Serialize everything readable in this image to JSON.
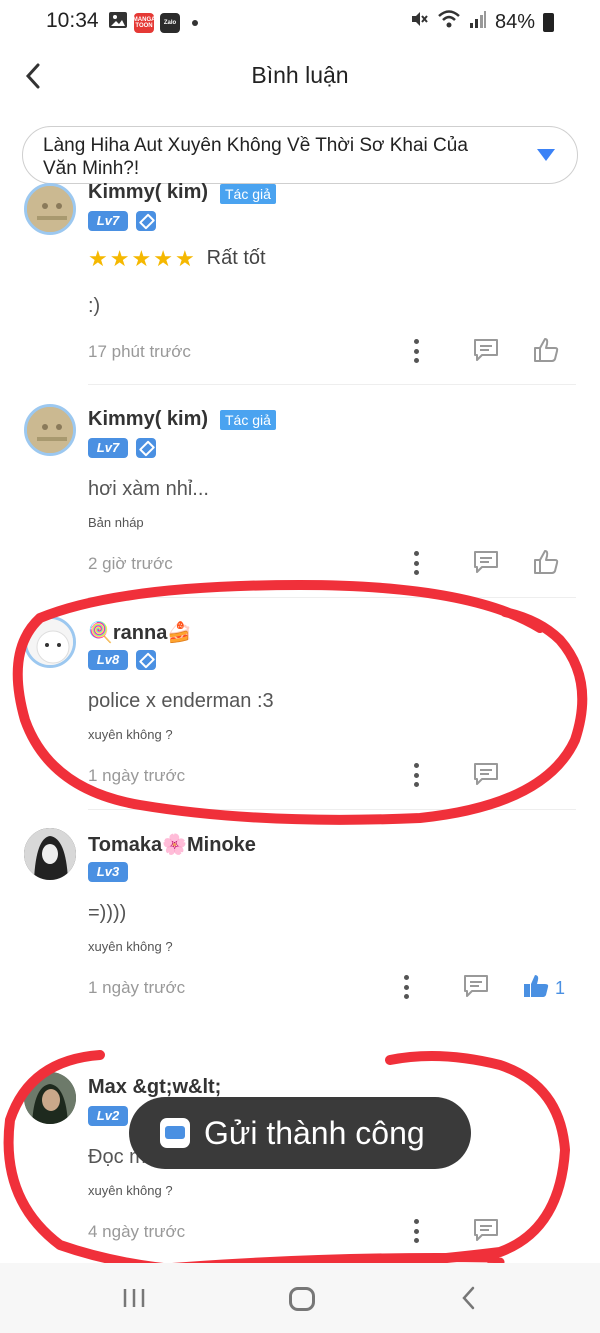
{
  "status_bar": {
    "time": "10:34",
    "battery": "84%",
    "app_badges": [
      {
        "label": "MANGA TOON",
        "color": "#e53935"
      },
      {
        "label": "Zalo",
        "color": "#2b2b2b"
      }
    ]
  },
  "header": {
    "title": "Bình luận"
  },
  "chapter_select": {
    "value": "Làng Hiha Aut Xuyên Không Về Thời Sơ Khai Của Văn Minh?!"
  },
  "comments": [
    {
      "username": "Kimmy( kim)",
      "author_tag": "Tác giả",
      "level": "Lv7",
      "rating_text": "Rất tốt",
      "stars": 5,
      "body": ":)",
      "time": "17 phút trước"
    },
    {
      "username": "Kimmy( kim)",
      "author_tag": "Tác giả",
      "level": "Lv7",
      "body": "hơi xàm nhỉ...",
      "sub": "Bản nháp",
      "time": "2 giờ trước"
    },
    {
      "username": "🍭ranna🍰",
      "level": "Lv8",
      "body": "police x enderman :3",
      "sub": "xuyên không ?",
      "time": "1 ngày trước"
    },
    {
      "username": "Tomaka🌸Minoke",
      "level": "Lv3",
      "body": "=))))",
      "sub": "xuyên không ?",
      "time": "1 ngày trước",
      "like_count": "1"
    },
    {
      "username": "Max &gt;w&lt;",
      "level": "Lv2",
      "body": "Đọc mê luôn",
      "sub": "xuyên không ?",
      "time": "4 ngày trước"
    }
  ],
  "toast": {
    "message": "Gửi thành công"
  },
  "colors": {
    "accent": "#4a90e2",
    "annotation": "#f0303a",
    "star": "#f5b800"
  }
}
